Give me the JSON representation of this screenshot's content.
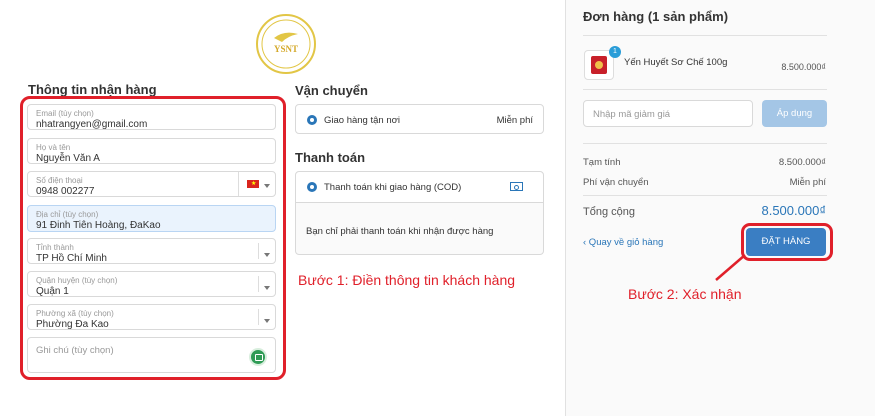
{
  "logo": {
    "text": "YSNT"
  },
  "shipping_info": {
    "title": "Thông tin nhận hàng",
    "email": {
      "label": "Email (tùy chọn)",
      "value": "nhatrangyen@gmail.com"
    },
    "name": {
      "label": "Họ và tên",
      "value": "Nguyễn Văn A"
    },
    "phone": {
      "label": "Số điện thoại",
      "value": "0948 002277"
    },
    "address": {
      "label": "Địa chỉ (tùy chọn)",
      "value": "91 Đinh Tiên Hoàng, ĐaKao"
    },
    "province": {
      "label": "Tỉnh thành",
      "value": "TP Hồ Chí Minh"
    },
    "district": {
      "label": "Quận huyện (tùy chọn)",
      "value": "Quận 1"
    },
    "ward": {
      "label": "Phường xã (tùy chọn)",
      "value": "Phường Đa Kao"
    },
    "note": {
      "placeholder": "Ghi chú (tùy chọn)"
    }
  },
  "shipping": {
    "title": "Vận chuyển",
    "option": "Giao hàng tận nơi",
    "price": "Miễn phí"
  },
  "payment": {
    "title": "Thanh toán",
    "option": "Thanh toán khi giao hàng (COD)",
    "note": "Bạn chỉ phải thanh toán khi nhận được hàng"
  },
  "annotations": {
    "step1": "Bước 1: Điền thông tin khách hàng",
    "step2": "Bước 2: Xác nhận"
  },
  "order": {
    "title": "Đơn hàng (1 sản phẩm)",
    "item": {
      "quantity": "1",
      "name": "Yến Huyết Sơ Chế 100g",
      "price": "8.500.000₫"
    },
    "discount_placeholder": "Nhập mã giảm giá",
    "apply_label": "Áp dụng",
    "subtotal_label": "Tạm tính",
    "subtotal_value": "8.500.000₫",
    "shipping_fee_label": "Phí vận chuyển",
    "shipping_fee_value": "Miễn phí",
    "total_label": "Tổng cộng",
    "total_value": "8.500.000₫",
    "back_link": "‹ Quay về giỏ hàng",
    "place_order": "ĐẶT HÀNG"
  },
  "colors": {
    "accent": "#3a7ec3",
    "annotation_red": "#e0202a"
  }
}
